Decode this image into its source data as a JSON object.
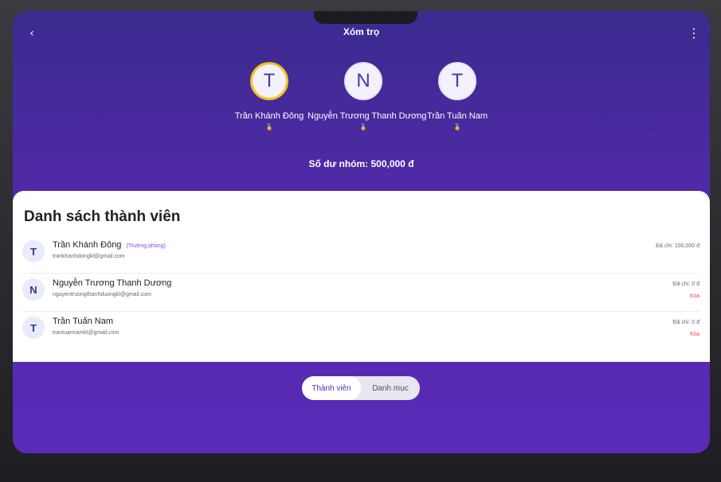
{
  "header": {
    "back_icon": "‹",
    "title": "Xóm trọ",
    "more_icon": "⋮"
  },
  "top_members": [
    {
      "initial": "T",
      "name": "Trần Khánh Đông",
      "medal": "gold"
    },
    {
      "initial": "N",
      "name": "Nguyễn Trương Thanh Dương",
      "medal": "silver"
    },
    {
      "initial": "T",
      "name": "Trần Tuấn Nam",
      "medal": "gold"
    }
  ],
  "balance_text": "Số dư nhóm: 500,000 đ",
  "member_list": {
    "title": "Danh sách thành viên",
    "rows": [
      {
        "initial": "T",
        "name": "Trần Khánh Đông",
        "role": "(Trưởng phòng)",
        "email": "trankhanhdongkl@gmail.com",
        "paid": "Đã chi: 100,000 đ",
        "delete": ""
      },
      {
        "initial": "N",
        "name": "Nguyễn Trương Thanh Dương",
        "role": "",
        "email": "nguyentruongthanhduongkl@gmail.com",
        "paid": "Đã chi: 0 đ",
        "delete": "Xóa"
      },
      {
        "initial": "T",
        "name": "Trần Tuấn Nam",
        "role": "",
        "email": "trantuannamkl@gmail.com",
        "paid": "Đã chi: 0 đ",
        "delete": "Xóa"
      }
    ]
  },
  "tabs": {
    "members": "Thành viên",
    "categories": "Danh mục"
  },
  "colors": {
    "accent": "#5a2ab8",
    "delete": "#e64848",
    "leader_ring": "#f0c419"
  }
}
